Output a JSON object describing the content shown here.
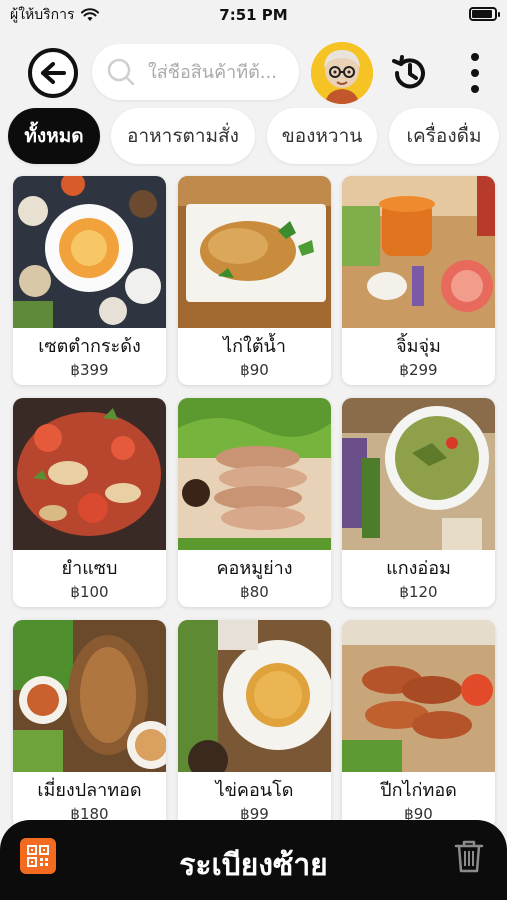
{
  "status_bar": {
    "carrier": "ผู้ให้บริการ",
    "time": "7:51 PM",
    "battery_level": 0.9
  },
  "header": {
    "search_placeholder": "ใส่ชื่อสินค้าที่ต้...",
    "icons": [
      "back-arrow",
      "search",
      "avatar",
      "history",
      "more-vertical"
    ]
  },
  "tabs": [
    {
      "label": "ทั้งหมด",
      "active": true
    },
    {
      "label": "อาหารตามสั่ง",
      "active": false
    },
    {
      "label": "ของหวาน",
      "active": false
    },
    {
      "label": "เครื่องดื่ม",
      "active": false
    }
  ],
  "products": [
    {
      "name": "เซตตำกระด้ง",
      "price": "฿399"
    },
    {
      "name": "ไก่ใต้น้ำ",
      "price": "฿90"
    },
    {
      "name": "จิ้มจุ่ม",
      "price": "฿299"
    },
    {
      "name": "ยำแซบ",
      "price": "฿100"
    },
    {
      "name": "คอหมูย่าง",
      "price": "฿80"
    },
    {
      "name": "แกงอ่อม",
      "price": "฿120"
    },
    {
      "name": "เมี่ยงปลาทอด",
      "price": "฿180"
    },
    {
      "name": "ไข่คอนโด",
      "price": "฿99"
    },
    {
      "name": "ปีกไก่ทอด",
      "price": "฿90"
    }
  ],
  "bottom_bar": {
    "title": "ระเบียงซ้าย",
    "icons": [
      "qr-code",
      "trash"
    ]
  },
  "colors": {
    "accent": "#f26b21",
    "dark": "#0c0c0c",
    "background": "#f2f2f2"
  }
}
